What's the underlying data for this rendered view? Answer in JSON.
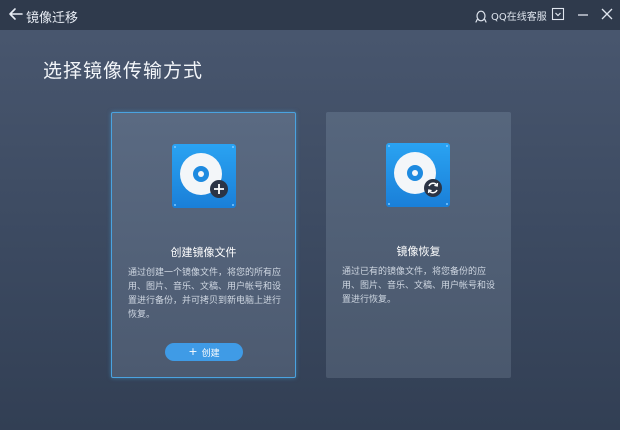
{
  "app": {
    "title": "镜像迁移",
    "support_label": "QQ在线客服"
  },
  "main": {
    "heading": "选择镜像传输方式"
  },
  "cards": [
    {
      "title": "创建镜像文件",
      "description": "通过创建一个镜像文件，将您的所有应用、图片、音乐、文稿、用户帐号和设置进行备份，并可拷贝到新电脑上进行恢复。",
      "button_label": "创建",
      "selected": true
    },
    {
      "title": "镜像恢复",
      "description": "通过已有的镜像文件，将您备份的应用、图片、音乐、文稿、用户帐号和设置进行恢复。",
      "selected": false
    }
  ],
  "colors": {
    "accent": "#3f9be6",
    "selected_border": "#4aa3e0",
    "titlebar": "#2f3a4c"
  }
}
